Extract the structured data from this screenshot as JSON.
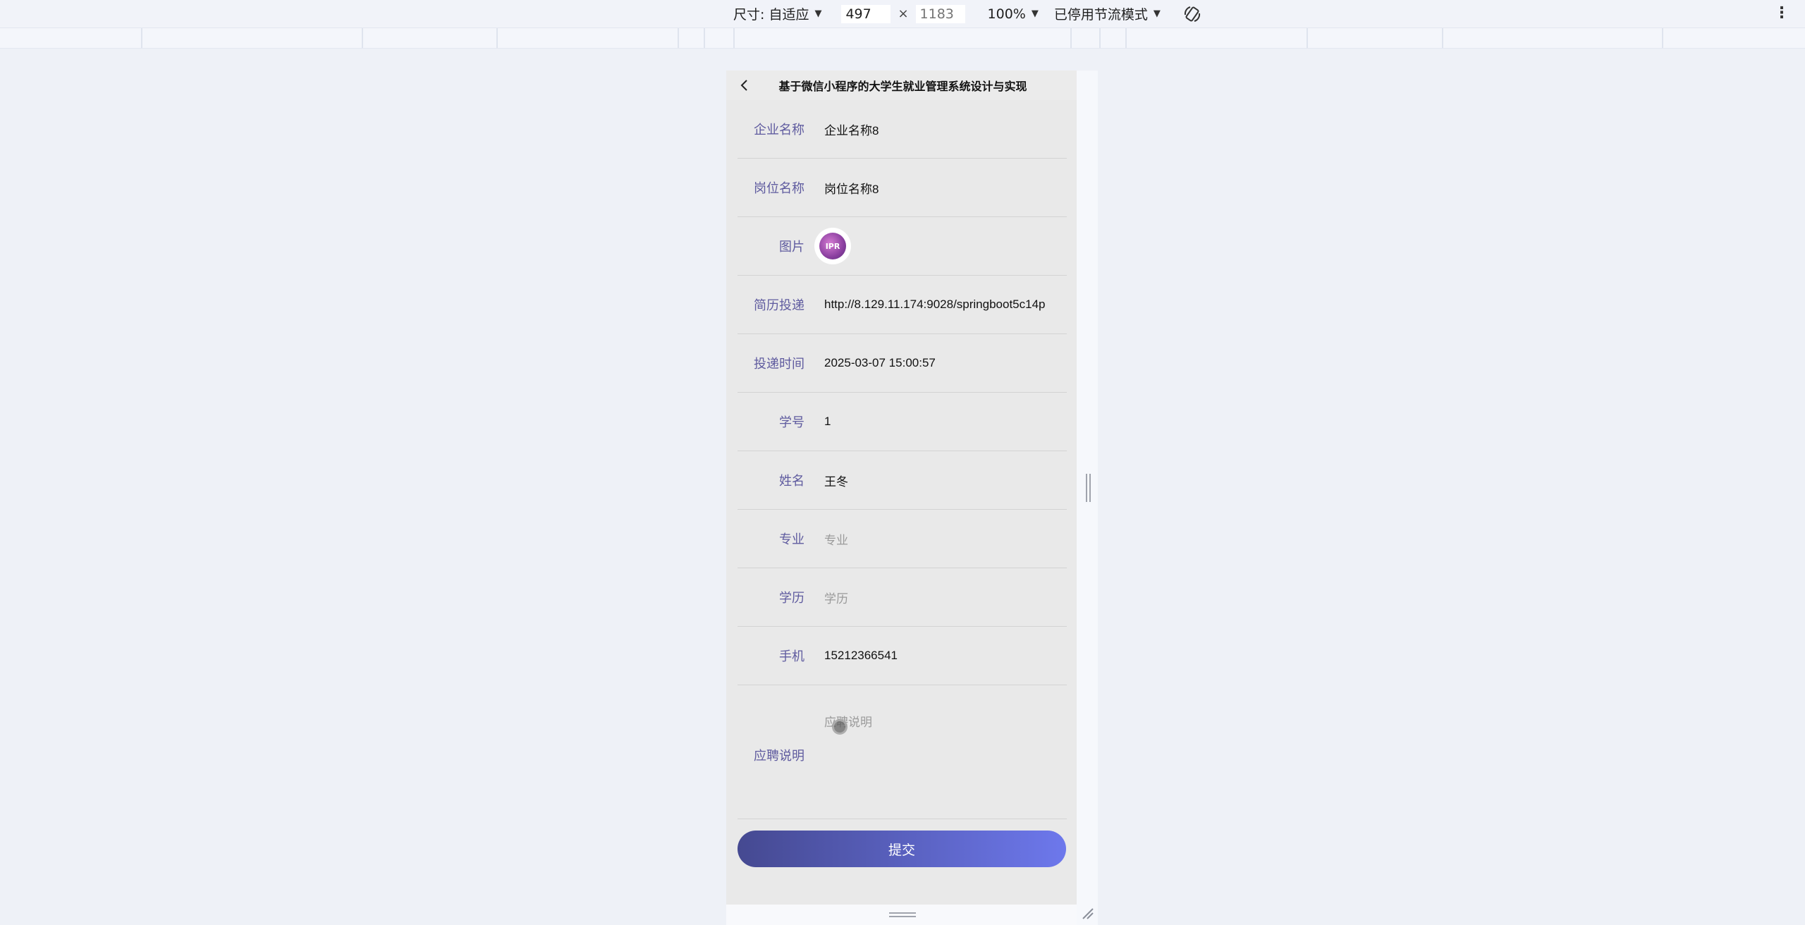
{
  "devtools": {
    "size_label": "尺寸: 自适应",
    "width_value": "497",
    "height_placeholder": "1183",
    "times_sign": "×",
    "zoom": "100%",
    "throttle": "已停用节流模式"
  },
  "page": {
    "title": "基于微信小程序的大学生就业管理系统设计与实现",
    "fields": [
      {
        "label": "企业名称",
        "value": "企业名称8"
      },
      {
        "label": "岗位名称",
        "value": "岗位名称8"
      },
      {
        "label": "图片",
        "image_text": "IPR"
      },
      {
        "label": "简历投递",
        "value": "http://8.129.11.174:9028/springboot5c14p"
      },
      {
        "label": "投递时间",
        "value": "2025-03-07 15:00:57"
      },
      {
        "label": "学号",
        "value": "1"
      },
      {
        "label": "姓名",
        "value": "王冬"
      },
      {
        "label": "专业",
        "placeholder": "专业"
      },
      {
        "label": "学历",
        "placeholder": "学历"
      },
      {
        "label": "手机",
        "value": "15212366541"
      },
      {
        "label": "应聘说明",
        "placeholder": "应聘说明"
      }
    ],
    "submit_label": "提交"
  },
  "colors": {
    "label": "#5f5b9f",
    "button_start": "#454991",
    "button_end": "#6d78ec"
  }
}
